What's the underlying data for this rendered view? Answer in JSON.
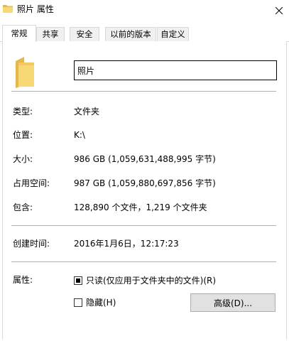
{
  "window": {
    "title": "照片 属性",
    "title_icon": "folder-icon",
    "close_icon": "close-icon"
  },
  "tabs": [
    {
      "label": "常规",
      "active": true
    },
    {
      "label": "共享",
      "active": false
    },
    {
      "label": "安全",
      "active": false
    },
    {
      "label": "以前的版本",
      "active": false
    },
    {
      "label": "自定义",
      "active": false
    }
  ],
  "general": {
    "folder_icon": "folder-icon",
    "name_value": "照片",
    "type_label": "类型:",
    "type_value": "文件夹",
    "location_label": "位置:",
    "location_value": "K:\\",
    "size_label": "大小:",
    "size_value": "986 GB (1,059,631,488,995 字节)",
    "size_on_disk_label": "占用空间:",
    "size_on_disk_value": "987 GB (1,059,880,697,856 字节)",
    "contains_label": "包含:",
    "contains_value": "128,890 个文件，1,219 个文件夹",
    "created_label": "创建时间:",
    "created_value": "2016年1月6日，12:17:23",
    "attributes_label": "属性:",
    "readonly_label": "只读(仅应用于文件夹中的文件)(R)",
    "readonly_state": "indeterminate",
    "hidden_label": "隐藏(H)",
    "hidden_checked": false,
    "advanced_button": "高级(D)..."
  },
  "colors": {
    "folder_yellow": "#f8d775",
    "folder_dark": "#e6b84a",
    "tab_border": "#d9d9d9",
    "button_bg": "#e1e1e1"
  }
}
